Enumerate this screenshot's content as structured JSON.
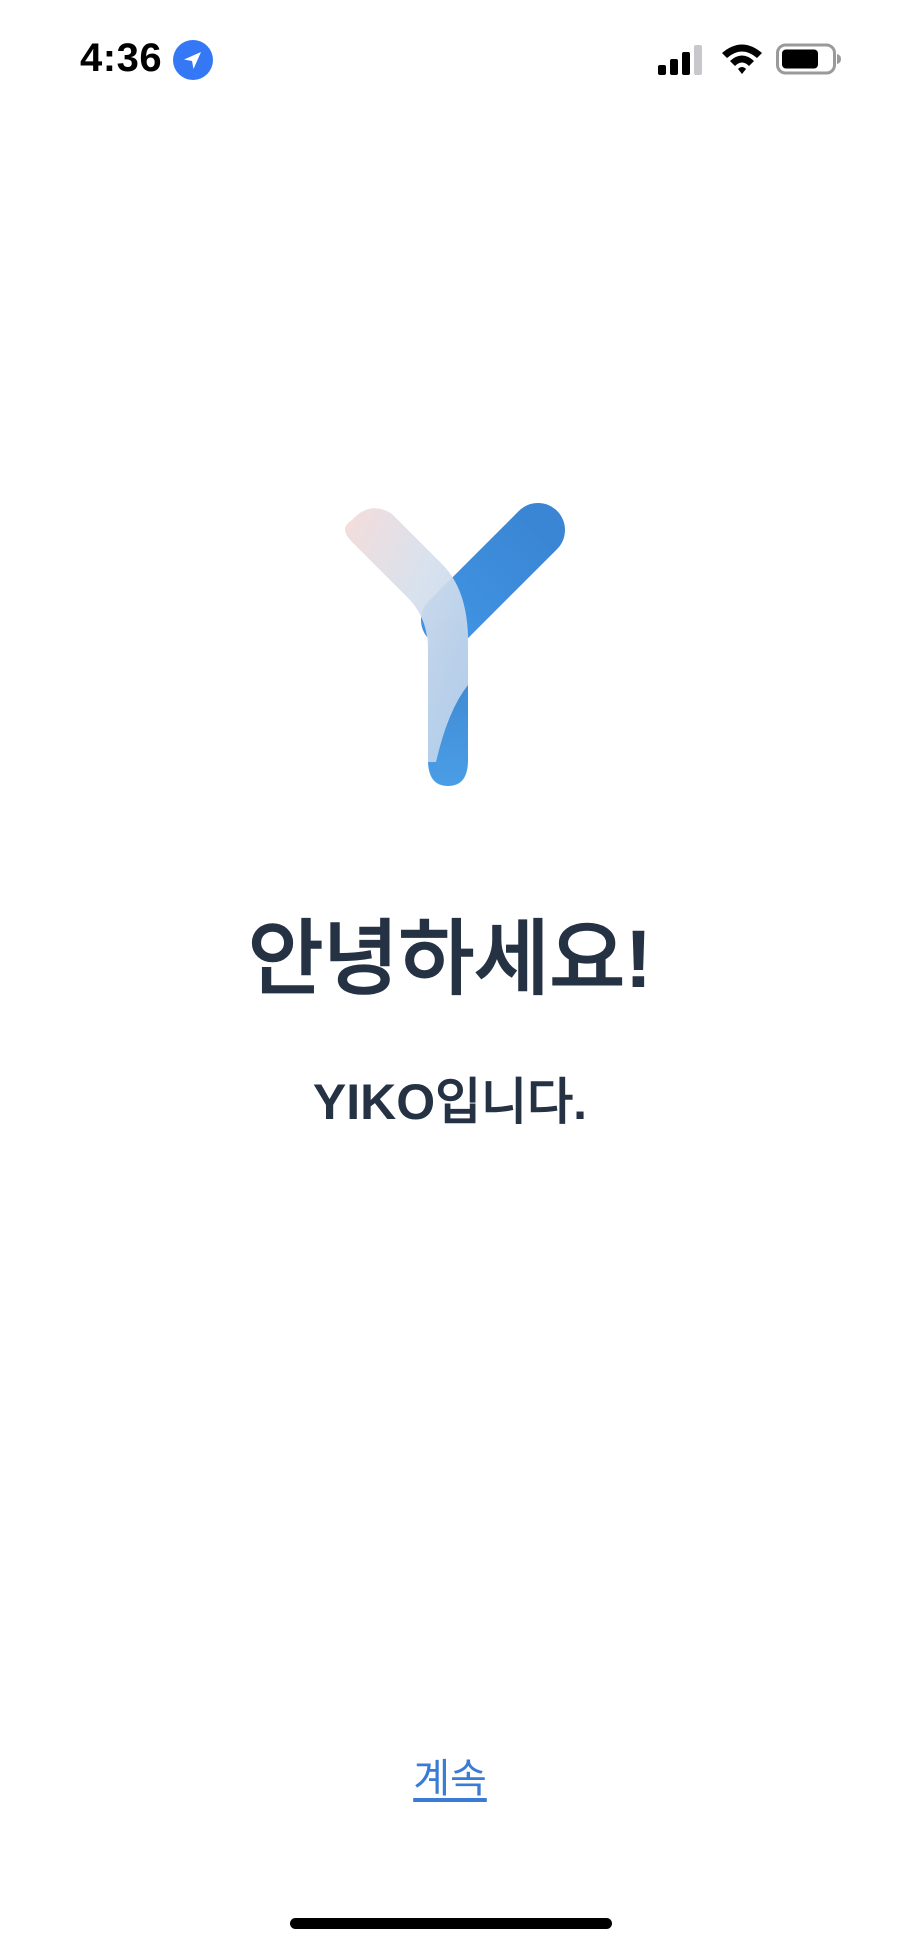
{
  "status_bar": {
    "time": "4:36",
    "icons": [
      "location-arrow-icon",
      "cellular-signal-icon",
      "wifi-icon",
      "battery-icon"
    ],
    "colors": {
      "location_badge": "#3478F6",
      "icon_fill": "#000000"
    }
  },
  "welcome": {
    "greeting": "안녕하세요!",
    "intro": "YIKO입니다.",
    "logo_icon": "yiko-y-logo-icon",
    "colors": {
      "text": "#253244",
      "logo_blue": "#3A8DDE",
      "logo_light": "#BFD6EE",
      "logo_pink": "#F2DCDA"
    }
  },
  "footer": {
    "continue_label": "계속",
    "link_color": "#3A7BD5"
  }
}
